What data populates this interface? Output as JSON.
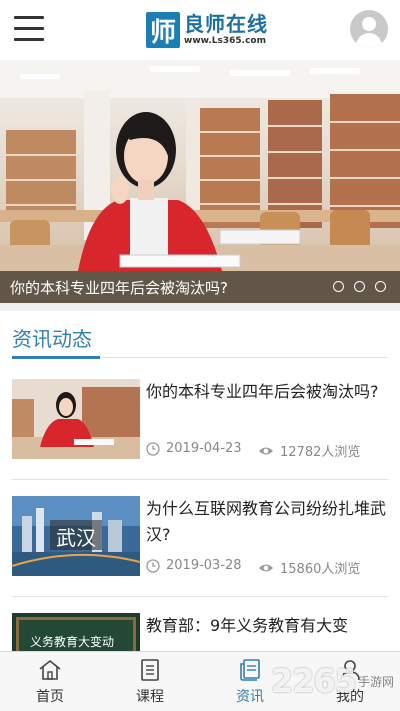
{
  "header": {
    "logo_mark": "师",
    "logo_name": "良师在线",
    "logo_url": "www.Ls365.com"
  },
  "banner": {
    "caption": "你的本科专业四年后会被淘汰吗?",
    "slide_count": 3,
    "active_slide": 1
  },
  "news": {
    "section_title": "资讯动态",
    "items": [
      {
        "title": "你的本科专业四年后会被淘汰吗?",
        "date": "2019-04-23",
        "views": "12782人浏览"
      },
      {
        "title": "为什么互联网教育公司纷纷扎堆武汉?",
        "date": "2019-03-28",
        "views": "15860人浏览",
        "thumb_text": "武汉"
      },
      {
        "title": "教育部：9年义务教育有大变",
        "thumb_text": "义务教育大变动"
      }
    ]
  },
  "tabbar": {
    "tabs": [
      {
        "label": "首页",
        "icon": "home-icon"
      },
      {
        "label": "课程",
        "icon": "course-icon"
      },
      {
        "label": "资讯",
        "icon": "news-icon",
        "active": true
      },
      {
        "label": "我的",
        "icon": "profile-icon"
      }
    ]
  },
  "watermark": {
    "number": "2265",
    "site": "手游网"
  },
  "colors": {
    "accent": "#2f7fb3",
    "logo": "#1b7fb5"
  }
}
